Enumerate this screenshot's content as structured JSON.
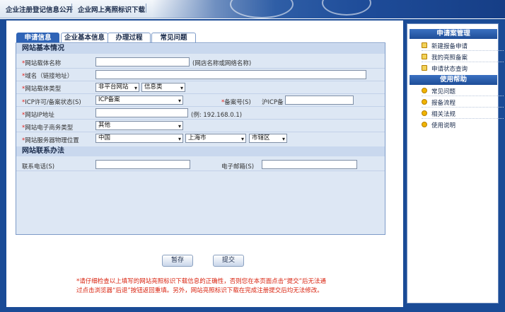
{
  "header": {
    "tab1": "企业注册登记信息公开",
    "tab2": "企业网上亮照标识下载"
  },
  "tabs": [
    "申请信息",
    "企业基本信息",
    "办理过程",
    "常见问题"
  ],
  "active_tab": 0,
  "sections": {
    "basic": "网站基本情况",
    "contact": "网站联系办法"
  },
  "fields": {
    "site_name": {
      "label": "网站载体名称",
      "value": "",
      "hint": "(网店名称或网络名称)"
    },
    "domain": {
      "label": "域名（链接地址）",
      "value": ""
    },
    "carrier_type": {
      "label": "网站载体类型",
      "select1": "非平台网站",
      "select2": "信息类"
    },
    "icp_status": {
      "label": "ICP许可/备案状态(S)",
      "select": "ICP备案"
    },
    "record_no": {
      "label": "备案号(S)",
      "prefix": "沪ICP备",
      "value": ""
    },
    "ip": {
      "label": "网站IP地址",
      "value": "",
      "hint": "(例: 192.168.0.1)"
    },
    "ecommerce_type": {
      "label": "网站电子商务类型",
      "select": "其他"
    },
    "server_location": {
      "label": "网站服务器物理位置",
      "country": "中国",
      "city": "上海市",
      "district": "市辖区"
    },
    "phone": {
      "label": "联系电话(S)",
      "value": ""
    },
    "email": {
      "label": "电子邮箱(S)",
      "value": ""
    }
  },
  "buttons": {
    "save": "暂存",
    "submit": "提交"
  },
  "notes": {
    "line1": "*请仔细检查以上填写的网站亮照标识下载信息的正确性，否则您在本页面点击“提交”后无法通",
    "line2": "过点击浏览器“后退”按钮返回重填。另外，网站亮照标识下载在完成注册提交后均无法修改。"
  },
  "sidebar": {
    "group1": {
      "title": "申请案管理",
      "items": [
        "新建报备申请",
        "我的亮照备案",
        "申请状态查询"
      ]
    },
    "group2": {
      "title": "使用帮助",
      "items": [
        "常见问题",
        "报备流程",
        "相关法规",
        "使用说明"
      ]
    }
  },
  "colors": {
    "frame_blue": "#1a4b96",
    "panel_bg": "#dde7f4",
    "required_red": "#e0211a",
    "tab_active": "#2f64b7"
  }
}
